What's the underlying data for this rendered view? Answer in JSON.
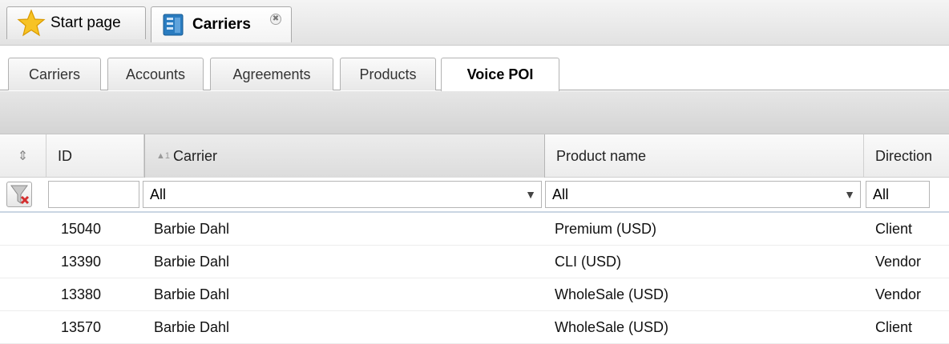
{
  "tabs": {
    "start": {
      "label": "Start page",
      "icon": "star-icon"
    },
    "carriers": {
      "label": "Carriers",
      "icon": "book-icon",
      "close": "✖"
    }
  },
  "subtabs": [
    "Carriers",
    "Accounts",
    "Agreements",
    "Products",
    "Voice POI"
  ],
  "active_subtab": "Voice POI",
  "grid": {
    "columns": {
      "id": "ID",
      "carrier": "Carrier",
      "carrier_sort": "▲1",
      "product": "Product name",
      "direction": "Direction"
    },
    "filters": {
      "id_value": "",
      "carrier": "All",
      "product": "All",
      "direction": "All"
    },
    "rows": [
      {
        "id": "15040",
        "carrier": "Barbie Dahl",
        "product": "Premium (USD)",
        "direction": "Client"
      },
      {
        "id": "13390",
        "carrier": "Barbie Dahl",
        "product": "CLI (USD)",
        "direction": "Vendor"
      },
      {
        "id": "13380",
        "carrier": "Barbie Dahl",
        "product": "WholeSale (USD)",
        "direction": "Vendor"
      },
      {
        "id": "13570",
        "carrier": "Barbie Dahl",
        "product": "WholeSale (USD)",
        "direction": "Client"
      }
    ]
  },
  "colors": {
    "accent": "#f5b800",
    "book": "#1f6fb2",
    "filter_border": "#c9d5e3"
  }
}
